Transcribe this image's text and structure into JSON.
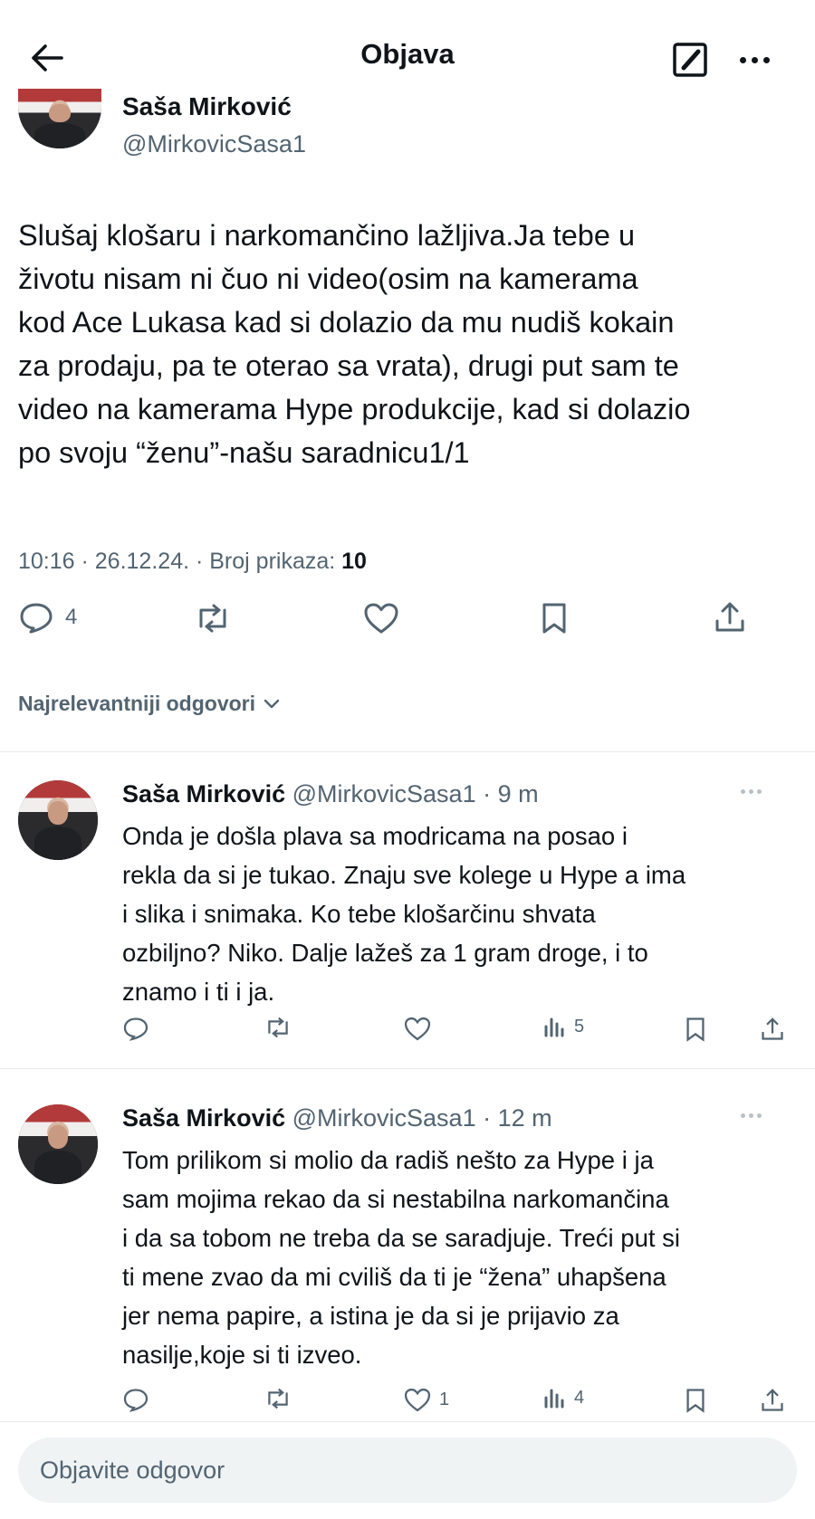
{
  "header": {
    "title": "Objava",
    "back_icon": "arrow-left-icon",
    "edit_icon": "edit-compose-icon",
    "more_icon": "more-horizontal-icon"
  },
  "post": {
    "author_name": "Saša Mirković",
    "author_handle": "@MirkovicSasa1",
    "text_lines": [
      "Slušaj klošaru i narkomančino lažljiva.Ja tebe u",
      "životu nisam ni čuo ni video(osim na kamerama",
      "kod Ace Lukasa kad si dolazio da mu nudiš kokain",
      "za prodaju, pa te oterao sa vrata), drugi put sam te",
      "video na kamerama Hype produkcije, kad si dolazio",
      "po svoju “ženu”-našu saradnicu1/1"
    ],
    "meta_prefix": "10:16 · 26.12.24. · Broj prikaza:",
    "views": "10",
    "reply_count": "4"
  },
  "sort_label": "Najrelevantniji odgovori",
  "replies": [
    {
      "name": "Saša Mirković",
      "handle_time": "@MirkovicSasa1 · 9 m",
      "lines": [
        "Onda je došla plava sa modricama na posao i",
        "rekla da si je tukao. Znaju sve kolege u Hype a ima",
        "i slika i snimaka. Ko tebe klošarčinu shvata",
        "ozbiljno? Niko. Dalje lažeš za 1 gram droge, i to",
        "znamo i ti i ja."
      ],
      "likes": "",
      "views": "5"
    },
    {
      "name": "Saša Mirković",
      "handle_time": "@MirkovicSasa1 · 12 m",
      "lines": [
        "Tom prilikom si molio da radiš nešto za Hype i ja",
        "sam mojima rekao da si nestabilna narkomančina",
        "i da sa tobom ne treba da se saradjuje. Treći put si",
        "ti mene zvao da mi cviliš da ti je “žena” uhapšena",
        "jer nema papire, a istina je da si je prijavio za",
        "nasilje,koje si ti izveo."
      ],
      "likes": "1",
      "views": "4"
    }
  ],
  "composer": {
    "placeholder": "Objavite odgovor"
  },
  "colors": {
    "text": "#0f1419",
    "secondary": "#536471",
    "divider": "#e7e9ea",
    "composer_bg": "#eff3f4"
  }
}
